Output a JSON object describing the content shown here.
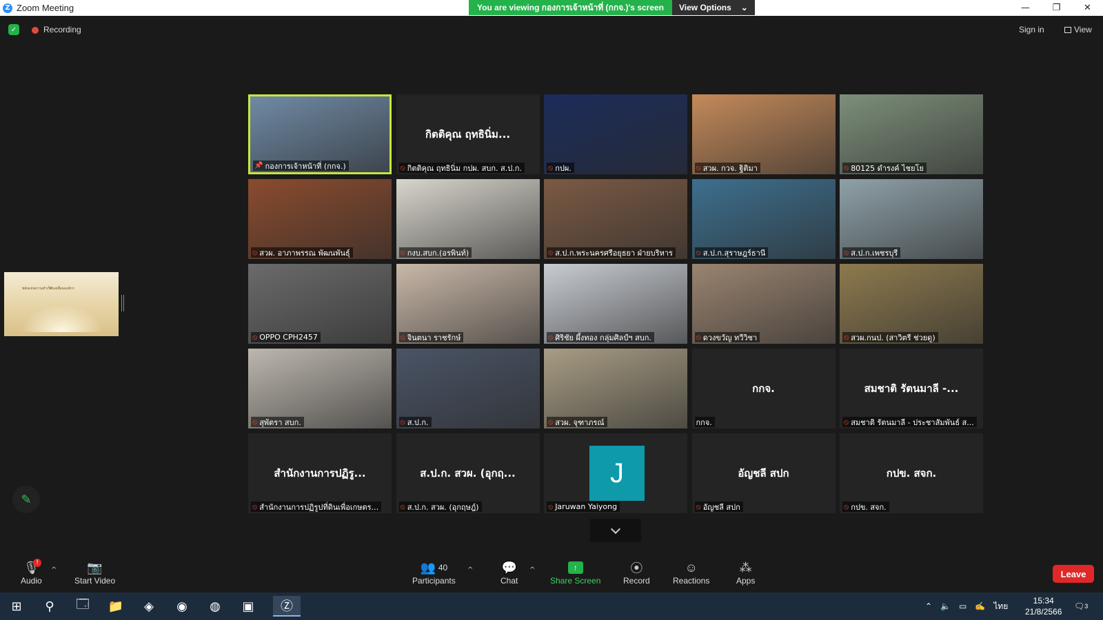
{
  "window": {
    "title": "Zoom Meeting",
    "logo": "Z",
    "share_banner": "You are viewing กองการเจ้าหน้าที่ (กกจ.)'s screen",
    "view_options": "View Options"
  },
  "status": {
    "recording": "Recording",
    "sign_in": "Sign in",
    "view": "View"
  },
  "thumbnail": {
    "text_left": "พลังแห่งความสำเร็จ",
    "text_right": "ขับเคลื่อนองค์กร"
  },
  "tiles": [
    {
      "label": "กองการเจ้าหน้าที่ (กกจ.)",
      "muted": false,
      "pinned": true,
      "active": true,
      "video": true,
      "bg": "#6f8aa5"
    },
    {
      "label": "กิตติคุณ ฤทธินิ่ม กปผ. สบก. ส.ป.ก.",
      "big": "กิตติคุณ ฤทธินิ่ม...",
      "muted": true,
      "video": false
    },
    {
      "label": "กปผ.",
      "muted": true,
      "video": true,
      "bg": "#1c2c5a"
    },
    {
      "label": "สวผ. กวจ. ฐิติมา",
      "muted": true,
      "video": true,
      "bg": "#c48a5a"
    },
    {
      "label": "80125 ดำรงค์ ไชยโย",
      "muted": true,
      "video": true,
      "bg": "#7d8f7a"
    },
    {
      "label": "สวผ. อาภาพรรณ พัฒนพันธุ์",
      "muted": true,
      "video": true,
      "bg": "#8a4b2e"
    },
    {
      "label": "กงบ.สบก.(อรพินท์)",
      "muted": true,
      "video": true,
      "bg": "#d8d5cc"
    },
    {
      "label": "ส.ป.ก.พระนครศรีอยุธยา ฝ่ายบริหาร",
      "muted": true,
      "video": true,
      "bg": "#7b5a44"
    },
    {
      "label": "ส.ป.ก.สุราษฎร์ธานี",
      "muted": true,
      "video": true,
      "bg": "#3d6f8e"
    },
    {
      "label": "ส.ป.ก.เพชรบุรี",
      "muted": true,
      "video": true,
      "bg": "#8ea1a8"
    },
    {
      "label": "OPPO CPH2457",
      "muted": true,
      "video": true,
      "bg": "#6b6b6b"
    },
    {
      "label": "จินตนา ราชรักษ์",
      "muted": true,
      "video": true,
      "bg": "#c9b8a8"
    },
    {
      "label": "ศิริชัย ผึ้งทอง กลุ่มศิลป์ฯ สบก.",
      "muted": true,
      "video": true,
      "bg": "#c8ccd2"
    },
    {
      "label": "ดวงขวัญ ทวีวิชา",
      "muted": true,
      "video": true,
      "bg": "#9a8470"
    },
    {
      "label": "สวผ.กนป. (สาวิตรี ช่วยดู)",
      "muted": true,
      "video": true,
      "bg": "#8e7a4e"
    },
    {
      "label": "สุพัตรา สบก.",
      "muted": true,
      "video": true,
      "bg": "#bdb7ae"
    },
    {
      "label": "ส.ป.ก.",
      "muted": true,
      "video": true,
      "bg": "#4a5466"
    },
    {
      "label": "สวผ. จุฑาภรณ์",
      "muted": true,
      "video": true,
      "bg": "#a89d84"
    },
    {
      "label": "กกจ.",
      "big": "กกจ.",
      "muted": false,
      "video": false
    },
    {
      "label": "สมชาติ รัตนมาลี - ประชาสัมพันธ์ ส...",
      "big": "สมชาติ รัตนมาลี -...",
      "muted": true,
      "video": false
    },
    {
      "label": "สำนักงานการปฏิรูปที่ดินเพื่อเกษตร...",
      "big": "สำนักงานการปฏิรู...",
      "muted": true,
      "video": false
    },
    {
      "label": "ส.ป.ก. สวผ. (อุกฤษฎ์)",
      "big": "ส.ป.ก. สวผ. (อุกฤ...",
      "muted": true,
      "video": false
    },
    {
      "label": "Jaruwan Yaiyong",
      "avatar": "J",
      "muted": true,
      "video": false
    },
    {
      "label": "อัญชลี สปก",
      "big": "อัญชลี สปก",
      "muted": true,
      "video": false
    },
    {
      "label": "กปข. สจก.",
      "big": "กปข. สจก.",
      "muted": true,
      "video": false
    }
  ],
  "toolbar": {
    "audio": "Audio",
    "audio_badge": "!",
    "start_video": "Start Video",
    "participants": "Participants",
    "participants_count": "40",
    "chat": "Chat",
    "share_screen": "Share Screen",
    "record": "Record",
    "reactions": "Reactions",
    "apps": "Apps",
    "leave": "Leave"
  },
  "taskbar": {
    "time": "15:34",
    "date": "21/8/2566",
    "language": "ไทย",
    "notifications": "3"
  },
  "colors": {
    "accent_green": "#24b24b",
    "leave_red": "#e02828",
    "active_border": "#c7e83c",
    "avatar_teal": "#0f9aaa"
  }
}
